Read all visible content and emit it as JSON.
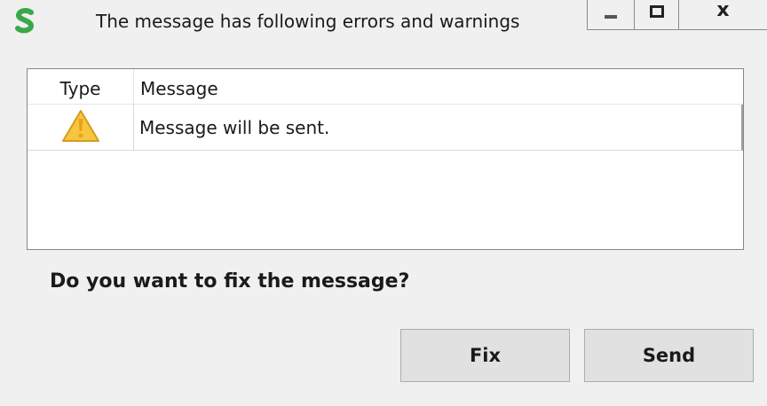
{
  "window": {
    "title": "The message has following errors and warnings",
    "app_icon": "green-s-logo-icon",
    "controls": {
      "minimize_icon": "minimize-icon",
      "maximize_icon": "maximize-icon",
      "close_label": "x"
    }
  },
  "table": {
    "columns": [
      "Type",
      "Message"
    ],
    "rows": [
      {
        "type_icon": "warning-icon",
        "message": "Message will be sent."
      }
    ]
  },
  "prompt": "Do you want to fix the message?",
  "buttons": {
    "fix_label": "Fix",
    "send_label": "Send"
  },
  "colors": {
    "background": "#f0f0f0",
    "app_icon_green": "#3aa84a",
    "warning_fill": "#f7c640",
    "warning_border": "#d89a1e",
    "button_face": "#e1e1e1"
  }
}
